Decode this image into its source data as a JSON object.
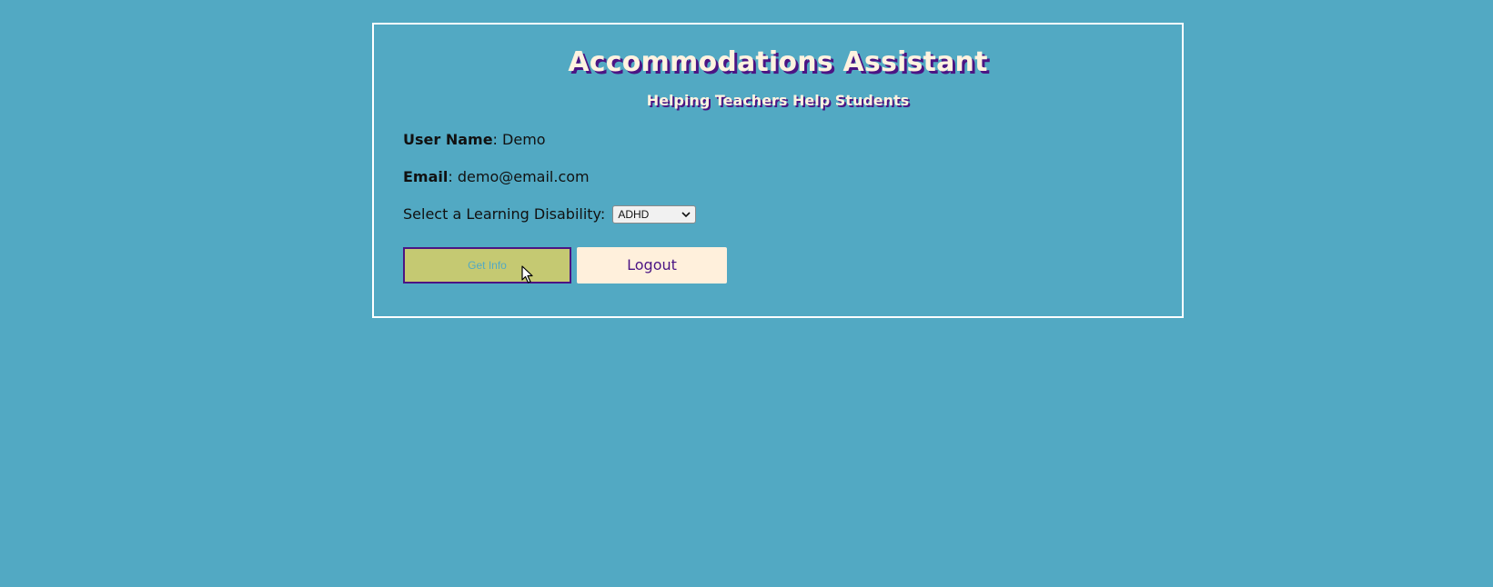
{
  "header": {
    "title": "Accommodations Assistant",
    "subtitle": "Helping Teachers Help Students"
  },
  "profile": {
    "user_name_label": "User Name",
    "user_name_value": "Demo",
    "email_label": "Email",
    "email_value": "demo@email.com"
  },
  "disability_select": {
    "label": "Select a Learning Disability:",
    "selected": "ADHD"
  },
  "buttons": {
    "get_info": "Get Info",
    "logout": "Logout"
  },
  "colors": {
    "background": "#52a9c3",
    "accent_purple": "#4b1584",
    "title_cream": "#fff3e0",
    "get_info_bg": "#c5c972",
    "logout_bg": "#fff0dc"
  },
  "icons": {
    "cursor": "mouse-pointer-icon",
    "select_arrow": "chevron-down-icon"
  }
}
